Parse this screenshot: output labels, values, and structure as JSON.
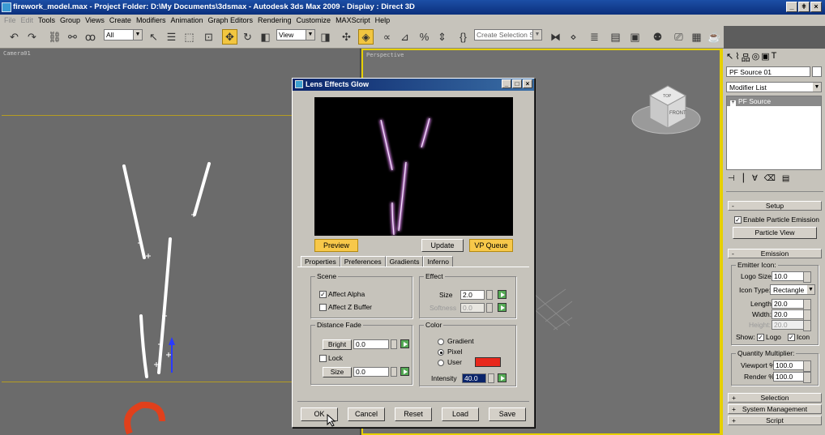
{
  "window": {
    "title": "firework_model.max    - Project Folder: D:\\My Documents\\3dsmax    - Autodesk 3ds Max  2009    - Display : Direct 3D",
    "controls": [
      "_",
      "ǂ",
      "×"
    ]
  },
  "menu": {
    "items": [
      "File",
      "Edit",
      "Tools",
      "Group",
      "Views",
      "Create",
      "Modifiers",
      "Animation",
      "Graph Editors",
      "Rendering",
      "Customize",
      "MAXScript",
      "Help"
    ]
  },
  "toolbar": {
    "filter_value": "All",
    "ref_coord_value": "View",
    "selection_set_placeholder": "Create Selection Set"
  },
  "viewports": {
    "left_label": "Camera01",
    "right_label": "Perspective",
    "viewcube_top": "TOP",
    "viewcube_front": "FRONT"
  },
  "command_panel": {
    "object_name": "PF Source 01",
    "modifier_list": "Modifier List",
    "stack_item": "PF Source",
    "setup": {
      "header": "Setup",
      "enable_emission": "Enable Particle Emission",
      "particle_view_button": "Particle View"
    },
    "emission": {
      "header": "Emission",
      "emitter_icon_group": "Emitter Icon:",
      "logo_size_label": "Logo Size:",
      "logo_size": "10.0",
      "icon_type_label": "Icon Type:",
      "icon_type": "Rectangle",
      "length_label": "Length:",
      "length": "20.0",
      "width_label": "Width:",
      "width": "20.0",
      "height_label": "Height:",
      "height": "20.0",
      "show_label": "Show:",
      "show_logo": "Logo",
      "show_icon": "Icon",
      "quantity_group": "Quantity Multiplier:",
      "viewport_label": "Viewport %",
      "viewport_value": "100.0",
      "render_label": "Render %",
      "render_value": "100.0"
    },
    "collapsed_rollouts": [
      "Selection",
      "System Management",
      "Script"
    ]
  },
  "dialog": {
    "title": "Lens Effects Glow",
    "preview_button": "Preview",
    "update_button": "Update",
    "vp_queue_button": "VP Queue",
    "tabs": [
      "Properties",
      "Preferences",
      "Gradients",
      "Inferno"
    ],
    "scene": {
      "label": "Scene",
      "affect_alpha": "Affect Alpha",
      "affect_z_buffer": "Affect Z Buffer"
    },
    "effect": {
      "label": "Effect",
      "size_label": "Size",
      "size_value": "2.0",
      "softness_label": "Softness",
      "softness_value": "0.0"
    },
    "distance_fade": {
      "label": "Distance Fade",
      "bright_button": "Bright",
      "bright_value": "0.0",
      "lock_label": "Lock",
      "size_button": "Size",
      "size_value": "0.0"
    },
    "color": {
      "label": "Color",
      "gradient": "Gradient",
      "pixel": "Pixel",
      "user": "User",
      "user_swatch": "#e8281c",
      "intensity_label": "Intensity",
      "intensity_value": "40.0"
    },
    "buttons": [
      "OK",
      "Cancel",
      "Reset",
      "Load",
      "Save"
    ]
  }
}
